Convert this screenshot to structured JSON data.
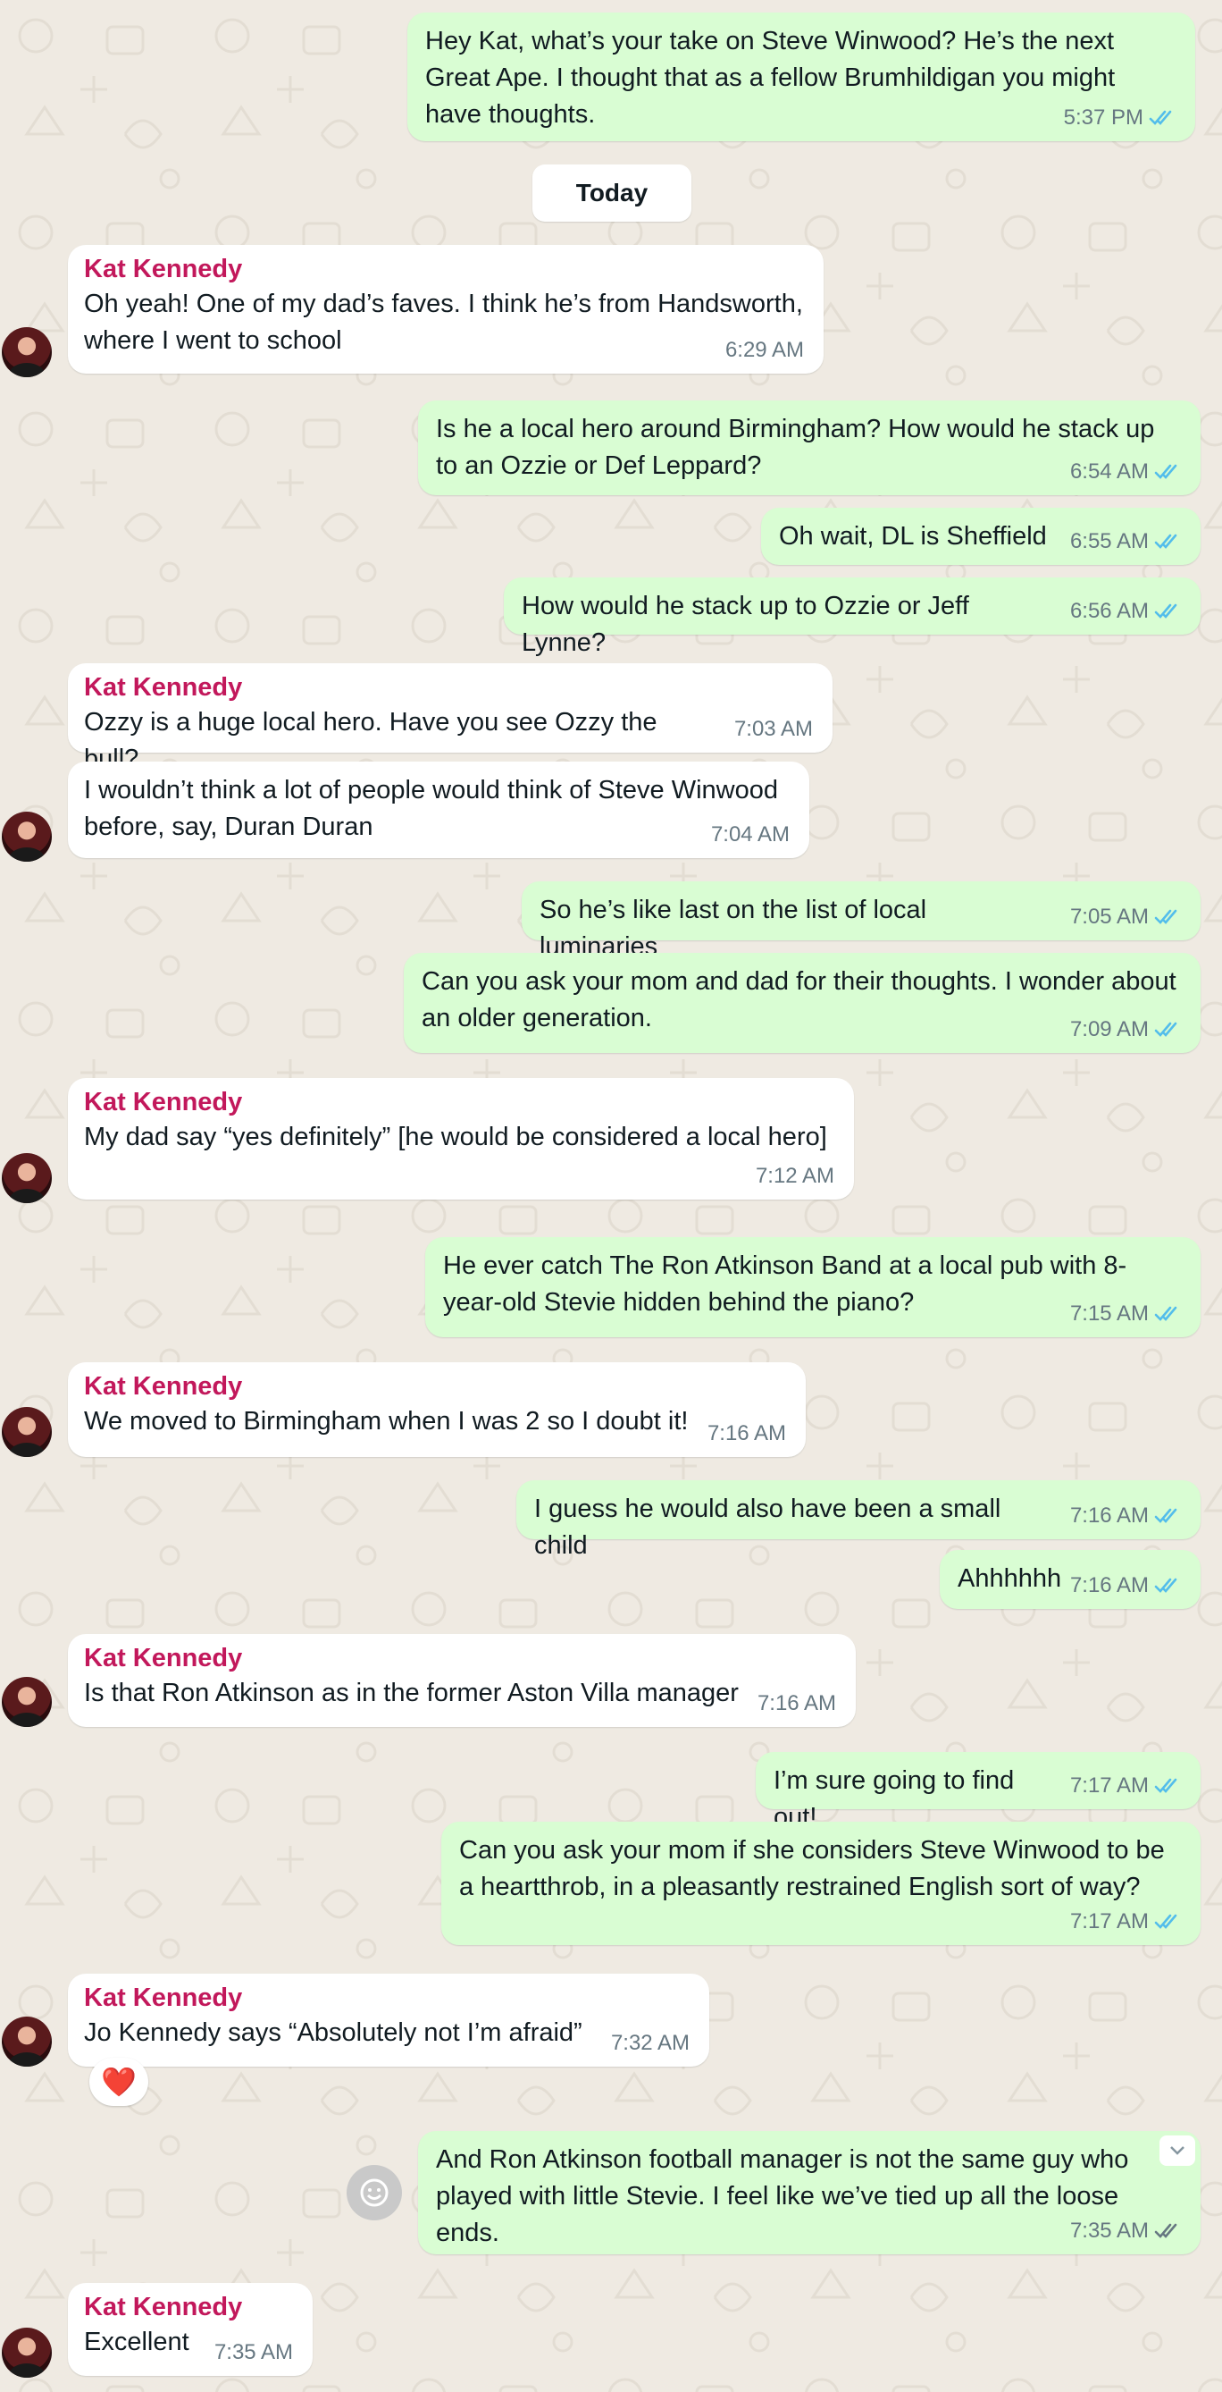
{
  "colors": {
    "outgoing_bubble": "#d9fdd3",
    "incoming_bubble": "#ffffff",
    "sender_name": "#c2185b",
    "read_ticks": "#53bdeb",
    "delivered_ticks": "#667781",
    "wallpaper": "#efeae2"
  },
  "chat": {
    "day_separator": "Today",
    "messages": [
      {
        "dir": "out",
        "text": "Hey Kat, what’s your take on Steve Winwood? He’s the next Great Ape. I thought that as a fellow Brumhildigan you might have thoughts.",
        "time": "5:37 PM",
        "status": "read"
      },
      {
        "dir": "in",
        "sender": "Kat Kennedy",
        "text": "Oh yeah! One of my dad’s faves. I think he’s from Handsworth, where I went to school",
        "time": "6:29 AM"
      },
      {
        "dir": "out",
        "text": "Is he a local hero around Birmingham? How would he stack up to an Ozzie or Def Leppard?",
        "time": "6:54 AM",
        "status": "read"
      },
      {
        "dir": "out",
        "text": "Oh wait, DL is Sheffield",
        "time": "6:55 AM",
        "status": "read"
      },
      {
        "dir": "out",
        "text": "How would he stack up to Ozzie or Jeff Lynne?",
        "time": "6:56 AM",
        "status": "read"
      },
      {
        "dir": "in",
        "sender": "Kat Kennedy",
        "text": "Ozzy is a huge local hero. Have you see Ozzy the bull?",
        "time": "7:03 AM"
      },
      {
        "dir": "in",
        "text": "I wouldn’t think a lot of people would think of Steve Winwood before, say, Duran Duran",
        "time": "7:04 AM"
      },
      {
        "dir": "out",
        "text": "So he’s like last on the list of local luminaries",
        "time": "7:05 AM",
        "status": "read"
      },
      {
        "dir": "out",
        "text": "Can you ask your mom and dad for their thoughts. I wonder about an older generation.",
        "time": "7:09 AM",
        "status": "read"
      },
      {
        "dir": "in",
        "sender": "Kat Kennedy",
        "text": "My dad say “yes definitely” [he would be considered a local hero]",
        "time": "7:12 AM"
      },
      {
        "dir": "out",
        "text": "He ever catch The Ron Atkinson Band at a local pub with 8-year-old Stevie hidden behind the piano?",
        "time": "7:15 AM",
        "status": "read"
      },
      {
        "dir": "in",
        "sender": "Kat Kennedy",
        "text": "We moved to Birmingham when I was 2 so I doubt it!",
        "time": "7:16 AM"
      },
      {
        "dir": "out",
        "text": "I guess he would also have been a small child",
        "time": "7:16 AM",
        "status": "read"
      },
      {
        "dir": "out",
        "text": "Ahhhhhh",
        "time": "7:16 AM",
        "status": "read"
      },
      {
        "dir": "in",
        "sender": "Kat Kennedy",
        "text": "Is that Ron Atkinson as in the former Aston Villa manager",
        "time": "7:16 AM"
      },
      {
        "dir": "out",
        "text": "I’m sure going to find out!",
        "time": "7:17 AM",
        "status": "read"
      },
      {
        "dir": "out",
        "text": "Can you ask your mom if she considers Steve Winwood to be a heartthrob, in a pleasantly restrained English sort of way?",
        "time": "7:17 AM",
        "status": "read"
      },
      {
        "dir": "in",
        "sender": "Kat Kennedy",
        "text": "Jo Kennedy says “Absolutely not I’m afraid”",
        "time": "7:32 AM",
        "reaction": "heart"
      },
      {
        "dir": "out",
        "text": "And Ron Atkinson football manager is not the same guy who played with little Stevie. I feel like we’ve tied up all the loose ends.",
        "time": "7:35 AM",
        "status": "delivered"
      },
      {
        "dir": "in",
        "sender": "Kat Kennedy",
        "text": "Excellent",
        "time": "7:35 AM"
      }
    ]
  },
  "reaction_emoji": "❤️",
  "icons": {
    "emoji_button": "smiley-icon",
    "message_menu": "chevron-down-icon",
    "read_receipt": "double-check-icon"
  }
}
